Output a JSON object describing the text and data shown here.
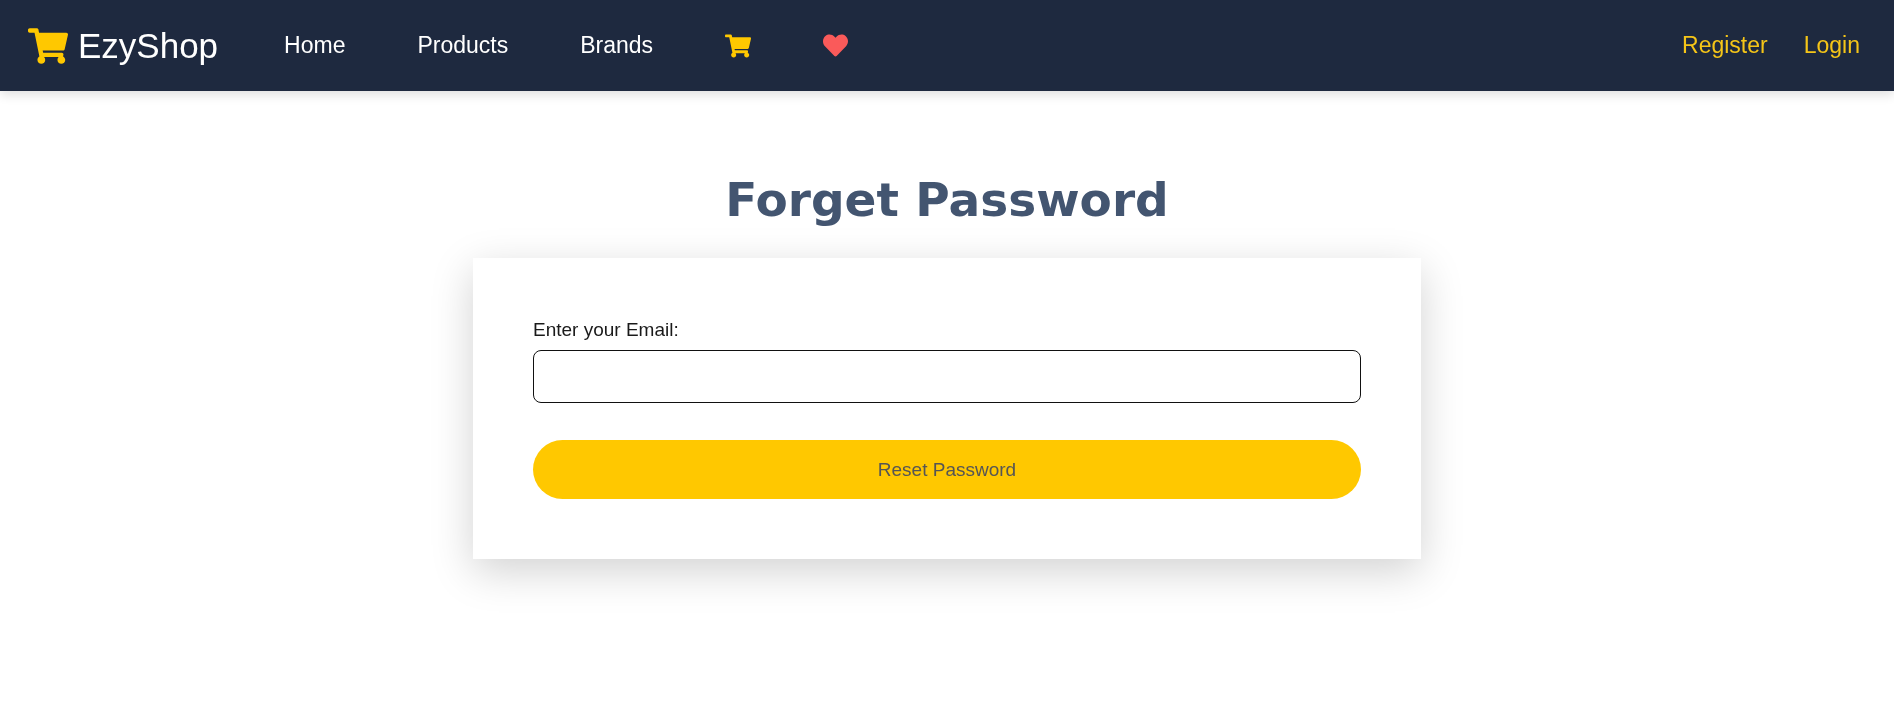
{
  "navbar": {
    "brand": "EzyShop",
    "links": [
      {
        "kind": "text",
        "label": "Home"
      },
      {
        "kind": "text",
        "label": "Products"
      },
      {
        "kind": "text",
        "label": "Brands"
      },
      {
        "kind": "cart"
      },
      {
        "kind": "wishlist"
      }
    ],
    "auth_links": [
      {
        "label": "Register"
      },
      {
        "label": "Login"
      }
    ]
  },
  "page": {
    "title": "Forget Password"
  },
  "form": {
    "email_label": "Enter your Email:",
    "submit_button": "Reset Password"
  }
}
